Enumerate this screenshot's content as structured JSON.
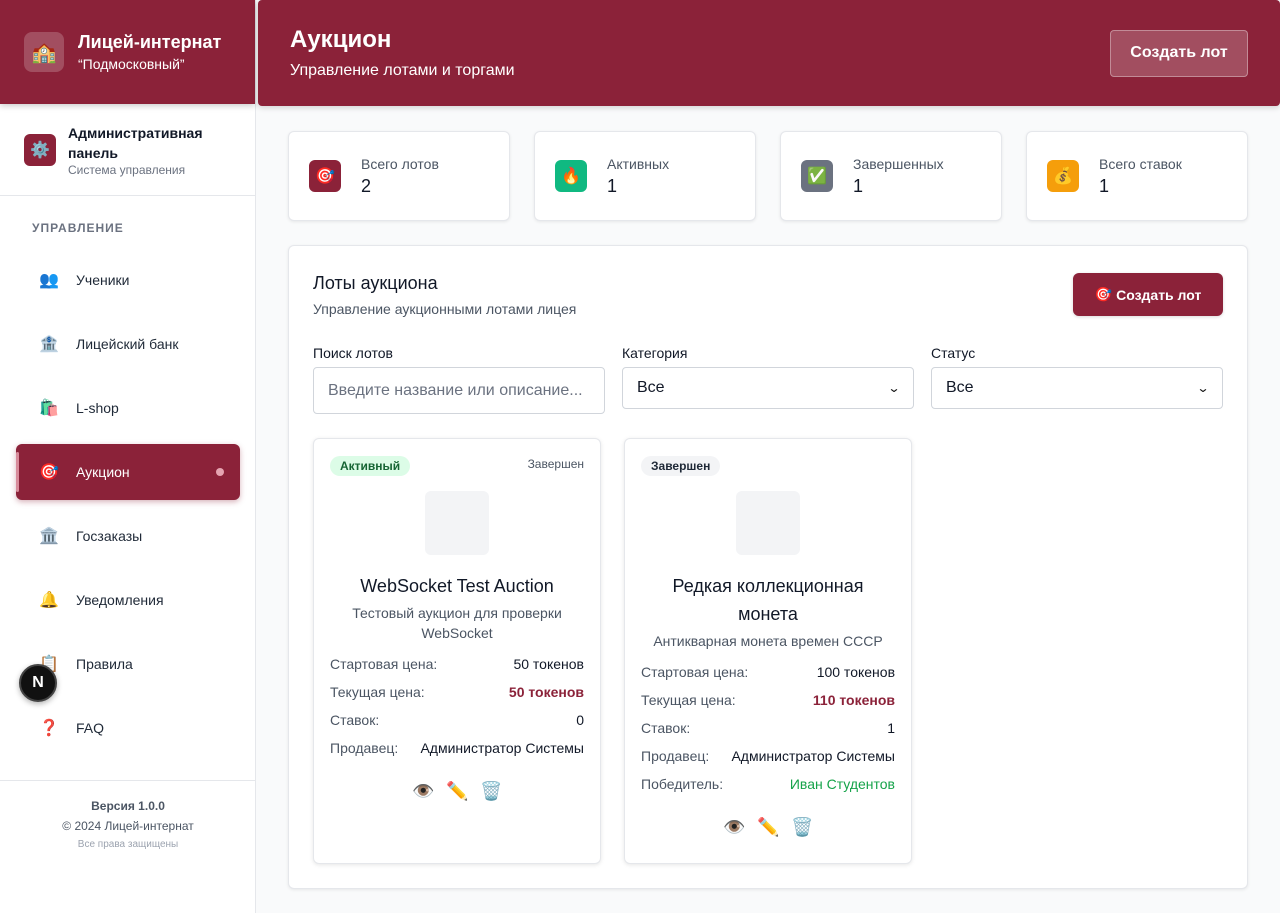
{
  "brand": {
    "icon": "school-icon",
    "title": "Лицей-интернат",
    "subtitle": "“Подмосковный”"
  },
  "admin": {
    "title": "Административная панель",
    "subtitle": "Система управления"
  },
  "nav": {
    "section_label": "УПРАВЛЕНИЕ",
    "items": [
      {
        "label": "Ученики",
        "glyph": "👥"
      },
      {
        "label": "Лицейский банк",
        "glyph": "🏦"
      },
      {
        "label": "L-shop",
        "glyph": "🛍️"
      },
      {
        "label": "Аукцион",
        "glyph": "🎯"
      },
      {
        "label": "Госзаказы",
        "glyph": "🏛️"
      },
      {
        "label": "Уведомления",
        "glyph": "🔔"
      },
      {
        "label": "Правила",
        "glyph": "📋"
      },
      {
        "label": "FAQ",
        "glyph": "❓"
      }
    ]
  },
  "footer": {
    "version": "Версия 1.0.0",
    "copyright": "© 2024 Лицей-интернат",
    "rights": "Все права защищены"
  },
  "dev_badge": "N",
  "header": {
    "title": "Аукцион",
    "subtitle": "Управление лотами и торгами",
    "create_label": "Создать лот"
  },
  "stats": [
    {
      "label": "Всего лотов",
      "value": "2",
      "glyph": "🎯",
      "color": "#8b2239"
    },
    {
      "label": "Активных",
      "value": "1",
      "glyph": "🔥",
      "color": "#10b981"
    },
    {
      "label": "Завершенных",
      "value": "1",
      "glyph": "✅",
      "color": "#6b7280"
    },
    {
      "label": "Всего ставок",
      "value": "1",
      "glyph": "💰",
      "color": "#f59e0b"
    }
  ],
  "panel": {
    "title": "Лоты аукциона",
    "subtitle": "Управление аукционными лотами лицея",
    "create_label": "Создать лот",
    "create_glyph": "🎯"
  },
  "filters": {
    "search_label": "Поиск лотов",
    "search_placeholder": "Введите название или описание...",
    "category_label": "Категория",
    "category_value": "Все",
    "status_label": "Статус",
    "status_value": "Все"
  },
  "lots": [
    {
      "badge": "Активный",
      "ended_tag": "Завершен",
      "title": "WebSocket Test Auction",
      "description": "Тестовый аукцион для проверки WebSocket",
      "start_label": "Стартовая цена:",
      "start_value": "50 токенов",
      "current_label": "Текущая цена:",
      "current_value": "50 токенов",
      "bids_label": "Ставок:",
      "bids_value": "0",
      "seller_label": "Продавец:",
      "seller_value": "Администратор Системы"
    },
    {
      "badge": "Завершен",
      "title": "Редкая коллекционная монета",
      "description": "Антикварная монета времен СССР",
      "start_label": "Стартовая цена:",
      "start_value": "100 токенов",
      "current_label": "Текущая цена:",
      "current_value": "110 токенов",
      "bids_label": "Ставок:",
      "bids_value": "1",
      "seller_label": "Продавец:",
      "seller_value": "Администратор Системы",
      "winner_label": "Победитель:",
      "winner_value": "Иван Студентов"
    }
  ],
  "action_glyphs": {
    "view": "👁️",
    "edit": "✏️",
    "delete": "🗑️"
  },
  "colors": {
    "accent": "#8b2239",
    "success": "#16a34a"
  }
}
